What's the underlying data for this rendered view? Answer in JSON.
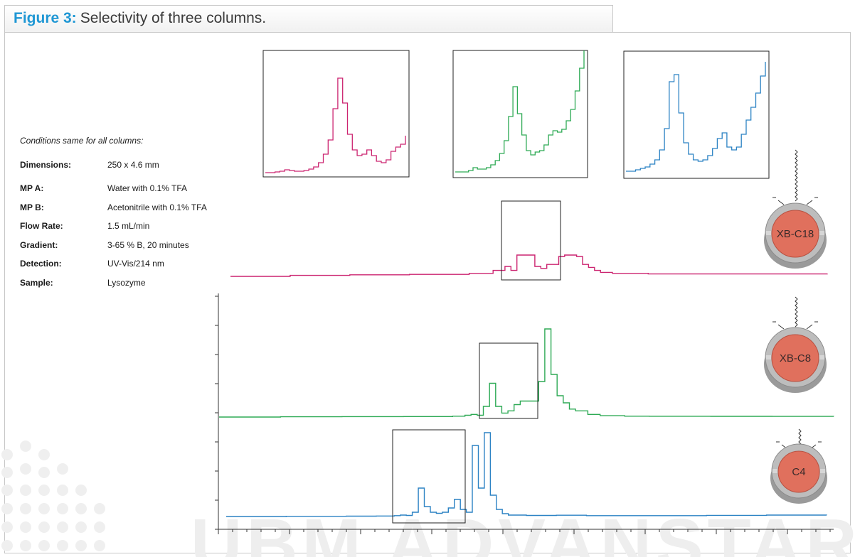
{
  "figure": {
    "label": "Figure 3:",
    "title": "Selectivity of three columns."
  },
  "conditions": {
    "title": "Conditions same for all columns:",
    "rows": [
      {
        "key": "Dimensions:",
        "value": "250 x 4.6 mm"
      },
      {
        "key": "MP A:",
        "value": "Water with 0.1% TFA"
      },
      {
        "key": "MP B:",
        "value": "Acetonitrile with 0.1% TFA"
      },
      {
        "key": "Flow Rate:",
        "value": "1.5 mL/min"
      },
      {
        "key": "Gradient:",
        "value": "3-65 % B, 20 minutes"
      },
      {
        "key": "Detection:",
        "value": "UV-Vis/214 nm"
      },
      {
        "key": "Sample:",
        "value": "Lysozyme"
      }
    ]
  },
  "colors": {
    "xb_c18": "#cc2470",
    "xb_c8": "#2eaa55",
    "c4": "#2b82c4",
    "badge_fill": "#e0705d",
    "badge_ring": "#bdbdbd"
  },
  "watermark": "UBM ADVANSTAR",
  "chart_data": {
    "type": "line",
    "title": "",
    "xlabel": "",
    "ylabel": "",
    "grid": false,
    "xlim": [
      0,
      100
    ],
    "series": [
      {
        "name": "XB-C18",
        "x": [
          0,
          10,
          20,
          30,
          40,
          44,
          46,
          47,
          48,
          49,
          50,
          51,
          52,
          53,
          55,
          56,
          57,
          58,
          59,
          60,
          61,
          62,
          64,
          70,
          80,
          90,
          100
        ],
        "y": [
          0.0,
          0.5,
          0.8,
          1.0,
          1.5,
          3.0,
          5.0,
          3.0,
          12.0,
          28.0,
          12.0,
          5.0,
          4.0,
          6.0,
          10.0,
          14.0,
          32.0,
          10.0,
          6.0,
          4.5,
          3.0,
          2.0,
          1.5,
          1.2,
          1.2,
          1.2,
          1.4
        ]
      },
      {
        "name": "XB-C8",
        "x": [
          0,
          10,
          20,
          30,
          38,
          40,
          41,
          42,
          43,
          44,
          45,
          46,
          47,
          48,
          49,
          50,
          52,
          53,
          54,
          55,
          56,
          57,
          58,
          60,
          62,
          66,
          70,
          80,
          90,
          100
        ],
        "y": [
          0.0,
          0.3,
          0.5,
          0.6,
          1.0,
          2.0,
          3.0,
          2.0,
          12.0,
          38.0,
          12.0,
          4.5,
          7.0,
          14.0,
          18.0,
          18.0,
          40.0,
          100.0,
          48.0,
          24.0,
          16.0,
          9.0,
          7.0,
          3.0,
          1.5,
          1.0,
          0.9,
          0.8,
          0.7,
          0.6
        ]
      },
      {
        "name": "C4",
        "x": [
          0,
          10,
          20,
          25,
          28,
          29,
          30,
          31,
          32,
          33,
          34,
          35,
          36,
          37,
          38,
          39,
          40,
          41,
          42,
          43,
          44,
          45,
          46,
          47,
          48,
          50,
          55,
          60,
          70,
          80,
          90,
          100
        ],
        "y": [
          0.0,
          0.3,
          0.5,
          0.7,
          1.2,
          2.0,
          1.5,
          6.0,
          40.0,
          14.0,
          6.0,
          4.5,
          6.0,
          12.0,
          24.0,
          10.0,
          6.0,
          100.0,
          40.0,
          120.0,
          30.0,
          10.0,
          4.0,
          2.0,
          2.0,
          1.5,
          1.8,
          1.2,
          1.2,
          1.6,
          2.0,
          1.8
        ]
      }
    ]
  },
  "badges": [
    {
      "label": "XB-C18"
    },
    {
      "label": "XB-C8"
    },
    {
      "label": "C4"
    }
  ]
}
